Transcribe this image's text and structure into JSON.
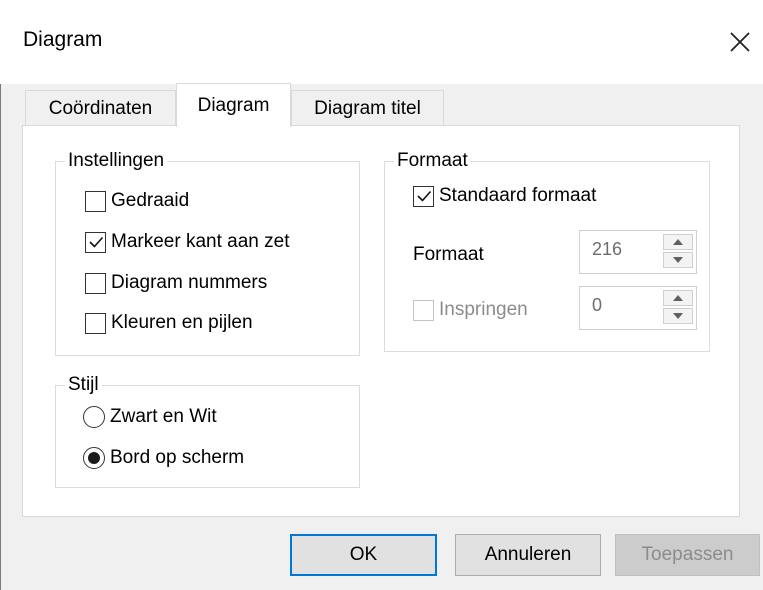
{
  "window": {
    "title": "Diagram"
  },
  "tabs": [
    {
      "label": "Coördinaten",
      "active": false
    },
    {
      "label": "Diagram",
      "active": true
    },
    {
      "label": "Diagram titel",
      "active": false
    }
  ],
  "instellingen": {
    "legend": "Instellingen",
    "options": [
      {
        "label": "Gedraaid",
        "checked": false
      },
      {
        "label": "Markeer kant aan zet",
        "checked": true
      },
      {
        "label": "Diagram nummers",
        "checked": false
      },
      {
        "label": "Kleuren en pijlen",
        "checked": false
      }
    ]
  },
  "stijl": {
    "legend": "Stijl",
    "options": [
      {
        "label": "Zwart en Wit",
        "selected": false
      },
      {
        "label": "Bord op scherm",
        "selected": true
      }
    ]
  },
  "formaat": {
    "legend": "Formaat",
    "standaard_label": "Standaard formaat",
    "standaard_checked": true,
    "formaat_label": "Formaat",
    "formaat_value": "216",
    "inspringen_label": "Inspringen",
    "inspringen_checked": false,
    "inspringen_value": "0"
  },
  "buttons": {
    "ok": "OK",
    "cancel": "Annuleren",
    "apply": "Toepassen"
  }
}
